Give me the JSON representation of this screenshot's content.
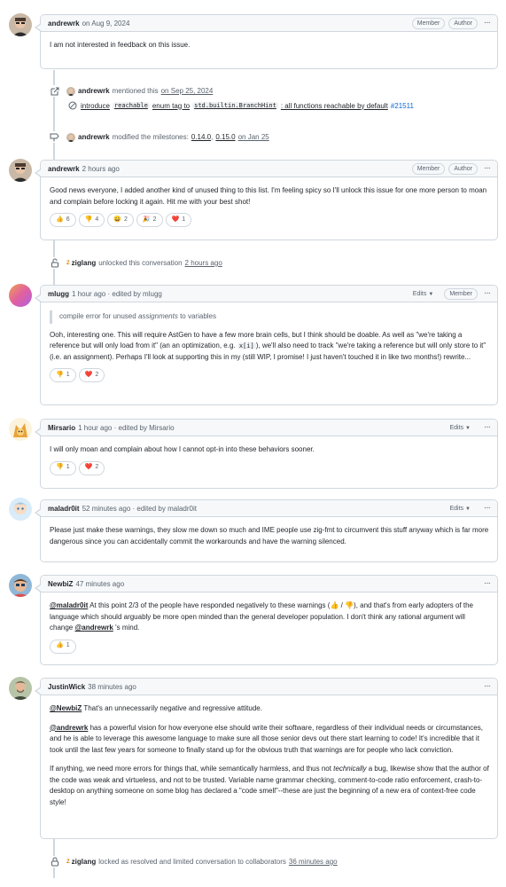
{
  "comments": [
    {
      "author": "andrewrk",
      "meta": "on Aug 9, 2024",
      "badges": [
        "Member",
        "Author"
      ],
      "body": [
        "I am not interested in feedback on this issue."
      ]
    },
    {
      "author": "andrewrk",
      "meta": "2 hours ago",
      "badges": [
        "Member",
        "Author"
      ],
      "body": [
        "Good news everyone, I added another kind of unused thing to this list. I'm feeling spicy so I'll unlock this issue for one more person to moan and complain before locking it again. Hit me with your best shot!"
      ],
      "reactions": [
        {
          "emoji": "👍",
          "count": "6"
        },
        {
          "emoji": "👎",
          "count": "4"
        },
        {
          "emoji": "😄",
          "count": "2"
        },
        {
          "emoji": "🎉",
          "count": "2"
        },
        {
          "emoji": "❤️",
          "count": "1"
        }
      ]
    },
    {
      "author": "mlugg",
      "meta": "1 hour ago · edited by mlugg",
      "edits": "Edits",
      "badges": [
        "Member"
      ],
      "quote_pre": "compile error for unused ",
      "quote_em": "assignments",
      "quote_post": " to variables",
      "body_a": "Ooh, interesting one. This will require AstGen to have a few more brain cells, but I think should be doable. As well as \"we're taking a reference but will only load from it\" (an an optimization, e.g. ",
      "body_code": "x[i]",
      "body_b": "), we'll also need to track \"we're taking a reference but will only store to it\" (i.e. an assignment). Perhaps I'll look at supporting this in my (still WIP, I promise! I just haven't touched it in like two months!) rewrite...",
      "reactions": [
        {
          "emoji": "👎",
          "count": "1"
        },
        {
          "emoji": "❤️",
          "count": "2"
        }
      ]
    },
    {
      "author": "Mirsario",
      "meta": "1 hour ago · edited by Mirsario",
      "edits": "Edits",
      "body": [
        "I will only moan and complain about how I cannot opt-in into these behaviors sooner."
      ],
      "reactions": [
        {
          "emoji": "👎",
          "count": "1"
        },
        {
          "emoji": "❤️",
          "count": "2"
        }
      ]
    },
    {
      "author": "maladr0it",
      "meta": "52 minutes ago · edited by maladr0it",
      "edits": "Edits",
      "body": [
        "Please just make these warnings, they slow me down so much and IME people use zig-fmt to circumvent this stuff anyway which is far more dangerous since you can accidentally commit the workarounds and have the warning silenced."
      ]
    },
    {
      "author": "NewbiZ",
      "meta": "47 minutes ago",
      "mention1": "@maladr0it",
      "text1": " At this point 2/3 of the people have responded negatively to these warnings (👍 / 👎), and that's from early adopters of the language which should arguably be more open minded than the general developer population. I don't think any rational argument will change ",
      "mention2": "@andrewrk",
      "text2": " 's mind.",
      "reactions": [
        {
          "emoji": "👍",
          "count": "1"
        }
      ]
    },
    {
      "author": "JustinWick",
      "meta": "38 minutes ago",
      "p1_mention": "@NewbiZ",
      "p1_text": " That's an unnecessarily negative and regressive attitude.",
      "p2_mention": "@andrewrk",
      "p2_text": " has a powerful vision for how everyone else should write their software, regardless of their individual needs or circumstances, and he is able to leverage this awesome language to make sure all those senior devs out there start learning to code! It's incredible that it took until the last few years for someone to finally stand up for the obvious truth that warnings are for people who lack conviction.",
      "p3_a": "If anything, we need more errors for things that, while semantically harmless, and thus not ",
      "p3_em": "technically",
      "p3_b": " a bug, likewise show that the author of the code was weak and virtueless, and not to be trusted. Variable name grammar checking, comment-to-code ratio enforcement, crash-to-desktop on anything someone on some blog has declared a \"code smell\"--these are just the beginning of a new era of context-free code style!"
    }
  ],
  "events": {
    "mention": {
      "actor": "andrewrk",
      "text": "mentioned this",
      "time": "on Sep 25, 2024"
    },
    "mention_ref": {
      "w1": "introduce",
      "code1": "reachable",
      "w2": "enum tag to",
      "code2": "std.builtin.BranchHint",
      "w3": ": all functions reachable by default",
      "num": "#21511"
    },
    "milestone": {
      "actor": "andrewrk",
      "text": "modified the milestones:",
      "m1": "0.14.0",
      "sep": ",",
      "m2": "0.15.0",
      "time": "on Jan 25"
    },
    "unlock": {
      "badge": "Z",
      "actor": "ziglang",
      "text": "unlocked this conversation",
      "time": "2 hours ago"
    },
    "lock": {
      "badge": "Z",
      "actor": "ziglang",
      "text": "locked as resolved and limited conversation to collaborators",
      "time": "36 minutes ago"
    }
  }
}
